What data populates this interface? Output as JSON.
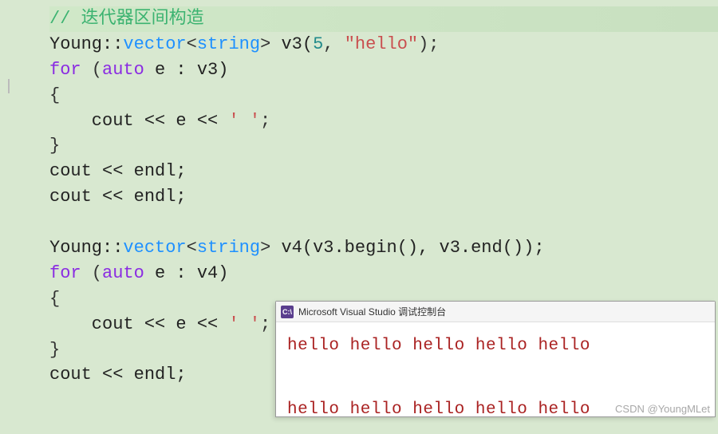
{
  "code": {
    "comment": "// 迭代器区间构造",
    "l1_ns": "Young::",
    "l1_vec": "vector",
    "l1_lt": "<",
    "l1_str": "string",
    "l1_gt": ">",
    "l1_var": " v3(",
    "l1_num": "5",
    "l1_comma": ", ",
    "l1_hello": "\"hello\"",
    "l1_end": ");",
    "l2_for": "for",
    "l2_open": " (",
    "l2_auto": "auto",
    "l2_rest": " e : v3)",
    "l3": "{",
    "l4_pad": "    cout << e << ",
    "l4_char": "' '",
    "l4_end": ";",
    "l5": "}",
    "l6": "cout << endl;",
    "l7": "cout << endl;",
    "l8": "",
    "l9_ns": "Young::",
    "l9_vec": "vector",
    "l9_lt": "<",
    "l9_str": "string",
    "l9_gt": ">",
    "l9_rest": " v4(v3.begin(), v3.end());",
    "l10_for": "for",
    "l10_open": " (",
    "l10_auto": "auto",
    "l10_rest": " e : v4)",
    "l11": "{",
    "l12_pad": "    cout << e << ",
    "l12_char": "' '",
    "l12_end": ";",
    "l13": "}",
    "l14": "cout << endl;"
  },
  "console": {
    "icon_text": "C:\\",
    "title": "Microsoft Visual Studio 调试控制台",
    "line1": "hello hello hello hello hello",
    "line2": "hello hello hello hello hello"
  },
  "watermark": "CSDN @YoungMLet"
}
